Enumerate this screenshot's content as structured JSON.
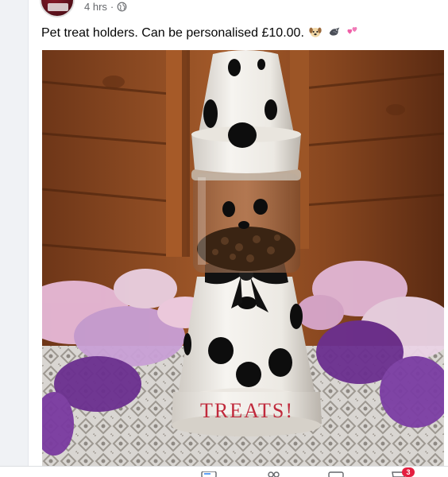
{
  "post": {
    "timestamp": "4 hrs",
    "separator": "·",
    "privacy_icon": "globe-icon",
    "caption": "Pet treat holders. Can be personalised £10.00.",
    "caption_emojis": [
      "dog-face-emoji",
      "pigeon-emoji",
      "two-hearts-emoji"
    ]
  },
  "photo": {
    "pot_text": "TREATS!",
    "colors": {
      "wood": "#8a4a22",
      "pot_white": "#f4f2ee",
      "spots": "#0d0d0d",
      "feather_pink": "#e7b9d8",
      "feather_purple": "#6b2f8f",
      "lettering": "#c02a3c"
    }
  },
  "bottom_nav": {
    "icons": [
      "news-feed-icon",
      "friends-icon",
      "watch-icon",
      "marketplace-icon"
    ],
    "badge_count": "3"
  }
}
